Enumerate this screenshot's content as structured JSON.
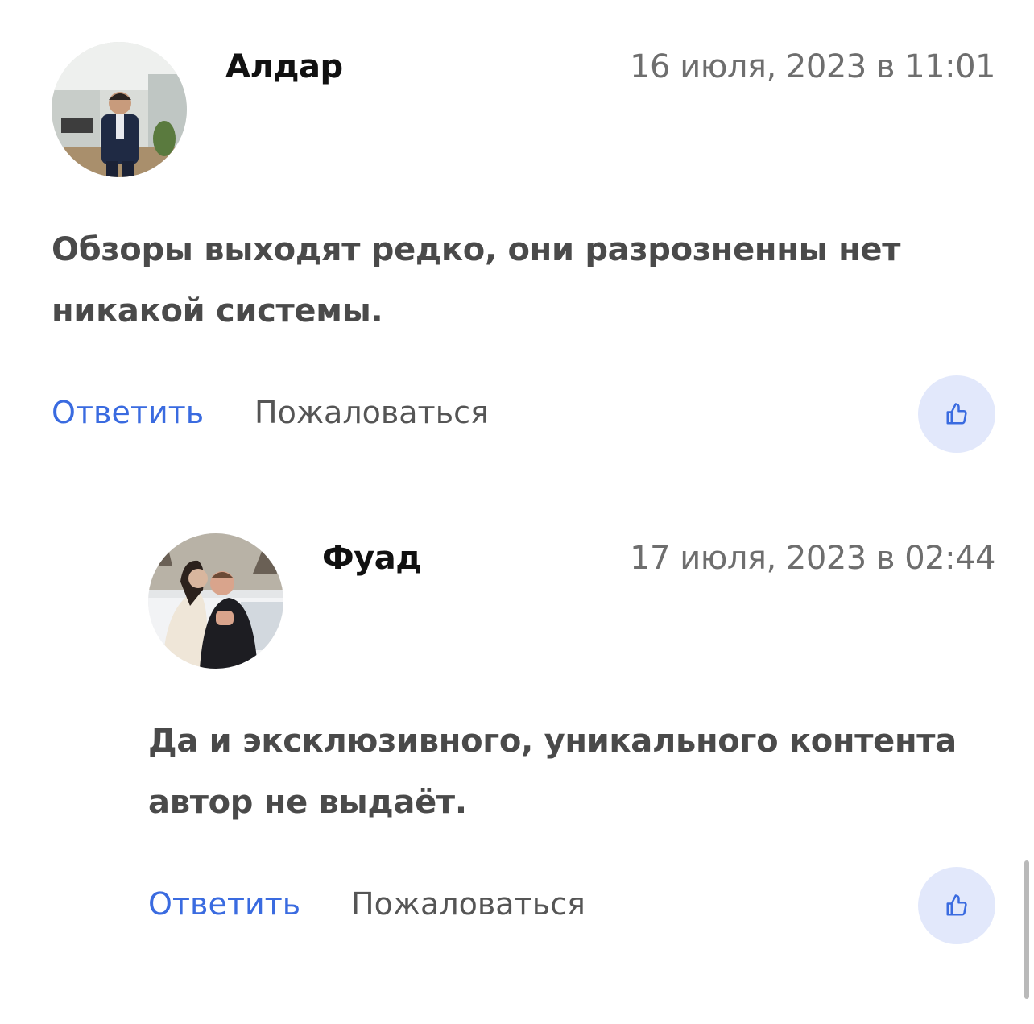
{
  "comments": [
    {
      "author": "Алдар",
      "date": "16 июля, 2023 в 11:01",
      "text": "Обзоры выходят редко, они разрозненны нет никакой системы.",
      "reply_label": "Ответить",
      "report_label": "Пожаловаться"
    },
    {
      "author": "Фуад",
      "date": "17 июля, 2023 в 02:44",
      "text": "Да и эксклюзивного, уникального контента автор не выдаёт.",
      "reply_label": "Ответить",
      "report_label": "Пожаловаться"
    }
  ],
  "colors": {
    "accent": "#3a6be0",
    "like_bg": "#e2e8fb",
    "text": "#4a4a4a",
    "muted": "#6e6e6e"
  },
  "icons": {
    "like": "thumbs-up-icon"
  }
}
